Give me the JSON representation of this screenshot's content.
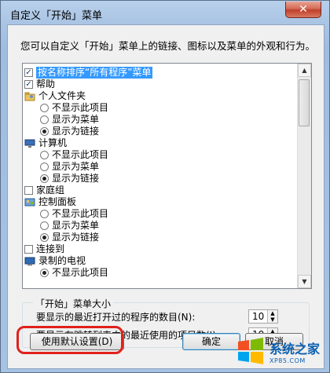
{
  "window": {
    "title": "自定义「开始」菜单",
    "close_symbol": "✕"
  },
  "description": "您可以自定义「开始」菜单上的链接、图标以及菜单的外观和行为。",
  "list": {
    "items": [
      {
        "type": "checkbox",
        "checked": true,
        "label": "按名称排序“所有程序”菜单",
        "selected": true
      },
      {
        "type": "checkbox",
        "checked": true,
        "label": "帮助"
      },
      {
        "type": "header",
        "icon": "folder-user-icon",
        "label": "个人文件夹"
      },
      {
        "type": "radio",
        "checked": false,
        "label": "不显示此项目"
      },
      {
        "type": "radio",
        "checked": false,
        "label": "显示为菜单"
      },
      {
        "type": "radio",
        "checked": true,
        "label": "显示为链接"
      },
      {
        "type": "header",
        "icon": "computer-icon",
        "label": "计算机"
      },
      {
        "type": "radio",
        "checked": false,
        "label": "不显示此项目"
      },
      {
        "type": "radio",
        "checked": false,
        "label": "显示为菜单"
      },
      {
        "type": "radio",
        "checked": true,
        "label": "显示为链接"
      },
      {
        "type": "checkbox",
        "checked": false,
        "label": "家庭组"
      },
      {
        "type": "header",
        "icon": "control-panel-icon",
        "label": "控制面板"
      },
      {
        "type": "radio",
        "checked": false,
        "label": "不显示此项目"
      },
      {
        "type": "radio",
        "checked": false,
        "label": "显示为菜单"
      },
      {
        "type": "radio",
        "checked": true,
        "label": "显示为链接"
      },
      {
        "type": "checkbox",
        "checked": false,
        "label": "连接到"
      },
      {
        "type": "header",
        "icon": "tv-icon",
        "label": "录制的电视"
      },
      {
        "type": "radio",
        "checked": true,
        "label": "不显示此项目"
      }
    ]
  },
  "menu_size": {
    "group_title": "「开始」菜单大小",
    "recent_programs_label": "要显示的最近打开过的程序的数目(N):",
    "recent_programs_value": "10",
    "jumplist_label": "要显示在跳转列表中的最近使用的项目数(J):",
    "jumplist_value": "10"
  },
  "buttons": {
    "defaults_label": "使用默认设置(D)",
    "ok_label": "确定",
    "cancel_label": "取消"
  },
  "watermark": {
    "title": "系统之家",
    "url": "XP85.COM"
  },
  "colors": {
    "highlight": "#3399ff",
    "red_ring": "#e0211c"
  }
}
